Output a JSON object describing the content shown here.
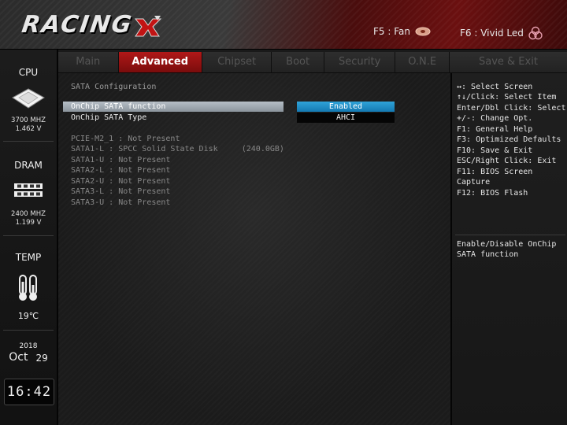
{
  "header": {
    "logo_text": "RACING",
    "fan_label": "F5 : Fan",
    "led_label": "F6 : Vivid Led"
  },
  "sidebar": {
    "cpu": {
      "label": "CPU",
      "freq": "3700 MHZ",
      "voltage": "1.462 V"
    },
    "dram": {
      "label": "DRAM",
      "freq": "2400 MHZ",
      "voltage": "1.199 V"
    },
    "temp": {
      "label": "TEMP",
      "value": "19℃"
    },
    "date": {
      "year": "2018",
      "month": "Oct",
      "day": "29"
    },
    "clock": "16:42"
  },
  "tabs": [
    {
      "label": "Main",
      "active": false
    },
    {
      "label": "Advanced",
      "active": true
    },
    {
      "label": "Chipset",
      "active": false
    },
    {
      "label": "Boot",
      "active": false
    },
    {
      "label": "Security",
      "active": false
    },
    {
      "label": "O.N.E",
      "active": false
    },
    {
      "label": "Save & Exit",
      "active": false
    }
  ],
  "main": {
    "section_title": "SATA Configuration",
    "items": [
      {
        "label": "OnChip SATA function",
        "value": "Enabled",
        "selected": true
      },
      {
        "label": "OnChip SATA Type",
        "value": "AHCI",
        "selected": false
      }
    ],
    "ports": [
      "PCIE-M2_1 : Not Present",
      "SATA1-L : SPCC Solid State Disk     (240.0GB)",
      "SATA1-U : Not Present",
      "SATA2-L : Not Present",
      "SATA2-U : Not Present",
      "SATA3-L : Not Present",
      "SATA3-U : Not Present"
    ]
  },
  "help": {
    "keys": [
      "↔: Select Screen",
      "↑↓/Click: Select Item",
      "Enter/Dbl Click: Select",
      "+/-: Change Opt.",
      "F1: General Help",
      "F3: Optimized Defaults",
      "F10: Save & Exit",
      "ESC/Right Click: Exit",
      "F11: BIOS Screen",
      "Capture",
      "F12: BIOS Flash"
    ],
    "description": [
      "Enable/Disable OnChip",
      "SATA function"
    ]
  },
  "colors": {
    "accent_red": "#b01818",
    "selection_blue": "#1479b2",
    "highlight_gray": "#9aa2aa"
  }
}
